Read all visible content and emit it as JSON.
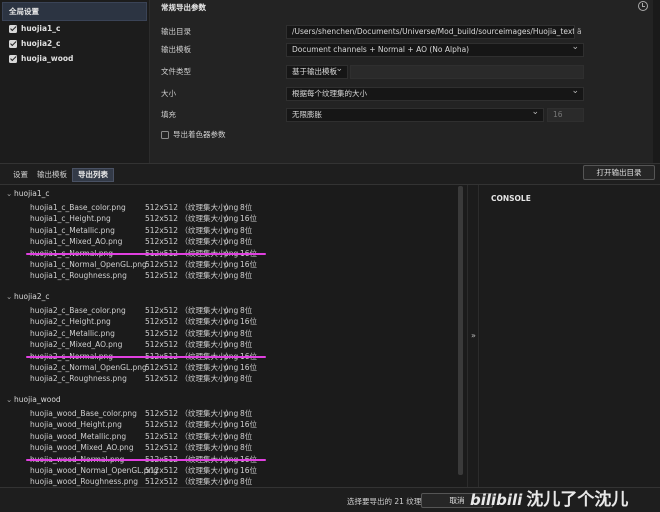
{
  "left_panel": {
    "global_settings": "全局设置",
    "texture_sets": [
      {
        "label": "huojia1_c",
        "checked": true
      },
      {
        "label": "huojia2_c",
        "checked": true
      },
      {
        "label": "huojia_wood",
        "checked": true
      }
    ]
  },
  "export_params": {
    "title": "常规导出参数",
    "output_dir_label": "输出目录",
    "output_dir_value": "/Users/shenchen/Documents/Universe/Mod_build/sourceimages/Huojia_text",
    "output_dir_tail": "ä",
    "template_label": "输出模板",
    "template_value": "Document channels + Normal + AO (No Alpha)",
    "file_type_label": "文件类型",
    "file_type_value": "基于输出模板",
    "size_label": "大小",
    "size_value": "根据每个纹理集的大小",
    "padding_label": "填充",
    "padding_value": "无限膨胀",
    "padding_number": "16",
    "export_shader_label": "导出着色器参数",
    "export_shader_checked": false
  },
  "tabs": [
    {
      "label": "设置",
      "active": false
    },
    {
      "label": "输出模板",
      "active": false
    },
    {
      "label": "导出列表",
      "active": true
    }
  ],
  "open_output_dir": "打开输出目录",
  "console_title": "CONSOLE",
  "groups": [
    {
      "name": "huojia1_c",
      "files": [
        {
          "name": "huojia1_c_Base_color.png",
          "size": "512x512 （纹理集大小）",
          "ext": "png",
          "bits": "8位"
        },
        {
          "name": "huojia1_c_Height.png",
          "size": "512x512 （纹理集大小）",
          "ext": "png",
          "bits": "16位"
        },
        {
          "name": "huojia1_c_Metallic.png",
          "size": "512x512 （纹理集大小）",
          "ext": "png",
          "bits": "8位"
        },
        {
          "name": "huojia1_c_Mixed_AO.png",
          "size": "512x512 （纹理集大小）",
          "ext": "png",
          "bits": "8位"
        },
        {
          "name": "huojia1_c_Normal.png",
          "size": "512x512 （纹理集大小）",
          "ext": "png",
          "bits": "16位"
        },
        {
          "name": "huojia1_c_Normal_OpenGL.png",
          "size": "512x512 （纹理集大小）",
          "ext": "png",
          "bits": "16位"
        },
        {
          "name": "huojia1_c_Roughness.png",
          "size": "512x512 （纹理集大小）",
          "ext": "png",
          "bits": "8位"
        }
      ]
    },
    {
      "name": "huojia2_c",
      "files": [
        {
          "name": "huojia2_c_Base_color.png",
          "size": "512x512 （纹理集大小）",
          "ext": "png",
          "bits": "8位"
        },
        {
          "name": "huojia2_c_Height.png",
          "size": "512x512 （纹理集大小）",
          "ext": "png",
          "bits": "16位"
        },
        {
          "name": "huojia2_c_Metallic.png",
          "size": "512x512 （纹理集大小）",
          "ext": "png",
          "bits": "8位"
        },
        {
          "name": "huojia2_c_Mixed_AO.png",
          "size": "512x512 （纹理集大小）",
          "ext": "png",
          "bits": "8位"
        },
        {
          "name": "huojia2_c_Normal.png",
          "size": "512x512 （纹理集大小）",
          "ext": "png",
          "bits": "16位"
        },
        {
          "name": "huojia2_c_Normal_OpenGL.png",
          "size": "512x512 （纹理集大小）",
          "ext": "png",
          "bits": "16位"
        },
        {
          "name": "huojia2_c_Roughness.png",
          "size": "512x512 （纹理集大小）",
          "ext": "png",
          "bits": "8位"
        }
      ]
    },
    {
      "name": "huojia_wood",
      "files": [
        {
          "name": "huojia_wood_Base_color.png",
          "size": "512x512 （纹理集大小）",
          "ext": "png",
          "bits": "8位"
        },
        {
          "name": "huojia_wood_Height.png",
          "size": "512x512 （纹理集大小）",
          "ext": "png",
          "bits": "16位"
        },
        {
          "name": "huojia_wood_Metallic.png",
          "size": "512x512 （纹理集大小）",
          "ext": "png",
          "bits": "8位"
        },
        {
          "name": "huojia_wood_Mixed_AO.png",
          "size": "512x512 （纹理集大小）",
          "ext": "png",
          "bits": "8位"
        },
        {
          "name": "huojia_wood_Normal.png",
          "size": "512x512 （纹理集大小）",
          "ext": "png",
          "bits": "16位"
        },
        {
          "name": "huojia_wood_Normal_OpenGL.png",
          "size": "512x512 （纹理集大小）",
          "ext": "png",
          "bits": "16位"
        },
        {
          "name": "huojia_wood_Roughness.png",
          "size": "512x512 （纹理集大小）",
          "ext": "png",
          "bits": "8位"
        }
      ]
    }
  ],
  "struck_out_files": [
    "huojia1_c_Normal.png",
    "huojia2_c_Normal.png",
    "huojia_wood_Normal.png"
  ],
  "selection_summary": "选择要导出的 21 纹理",
  "cancel_label": "取消",
  "watermark": {
    "logo": "bilibili",
    "text": "沈儿了个沈儿"
  },
  "colors": {
    "strike": "#e040e0",
    "active_tab": "#333a47",
    "background": "#1b1b1b"
  }
}
